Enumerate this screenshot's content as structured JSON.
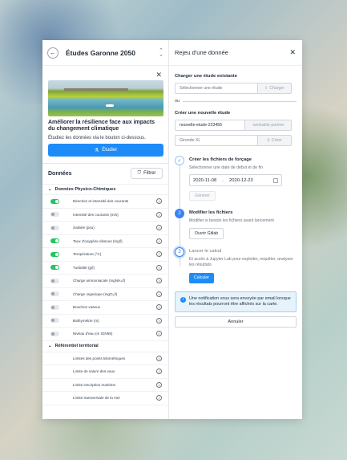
{
  "left": {
    "title": "Études Garonne 2050",
    "back_icon": "arrow-left-icon",
    "card": {
      "title": "Améliorer la résilience face aux impacts du changement climatique",
      "description": "Étudiez les données via le bouton ci-dessous.",
      "button_label": "Étudier"
    },
    "donnees_title": "Données",
    "filter_label": "Filtrer",
    "sections": [
      {
        "title": "Données Physico-Chimiques",
        "items": [
          {
            "label": "Direction et intensité des courants",
            "on": true
          },
          {
            "label": "Intensité des courants (m/s)",
            "on": false
          },
          {
            "label": "Salinité (psu)",
            "on": false
          },
          {
            "label": "Taux d'oxygène dissous (mg/l)",
            "on": true
          },
          {
            "label": "Température (°C)",
            "on": true
          },
          {
            "label": "Turbidité (g/l)",
            "on": true
          },
          {
            "label": "Charge ammoniacale (mgNH₄/l)",
            "on": false
          },
          {
            "label": "Charge organique (mgO₂/l)",
            "on": false
          },
          {
            "label": "Bouchon vaseux",
            "on": false
          },
          {
            "label": "Bathymétrie (m)",
            "on": false
          },
          {
            "label": "Niveau d'eau (m IGN69)",
            "on": false
          }
        ]
      },
      {
        "title": "Référentiel territorial",
        "items": [
          {
            "label": "Limites des points kilométriques"
          },
          {
            "label": "Limite de salure des eaux"
          },
          {
            "label": "Limite inscription maritime"
          },
          {
            "label": "Limite transversale de la mer"
          }
        ]
      }
    ]
  },
  "right": {
    "title": "Rejeu d'une donnée",
    "load_label": "Charger une étude existante",
    "select_placeholder": "Sélectionner une étude",
    "load_button": "Charger",
    "or_label": "ou",
    "create_label": "Créer une nouvelle étude",
    "new_study_name": "nouvelle-etude-223456",
    "new_study_suffix": "-workable-partner",
    "new_study_location": "Gironde XL",
    "create_button": "Créer",
    "steps": [
      {
        "title": "Créer les fichiers de forçage",
        "description": "Sélectionner une date de début et de fin",
        "start_date": "2020-11-08",
        "end_date": "2020-12-23",
        "button": "Générer"
      },
      {
        "number": "2",
        "title": "Modifier les fichiers",
        "description": "Modifier si besoin les fichiers avant lancement",
        "button": "Ouvrir Gitlab"
      },
      {
        "number": "3",
        "title": "Lancer le calcul",
        "description": "Et accès à Jupyter Lab pour exploiter, requêter, analyser les résultats",
        "button": "Calculer"
      }
    ],
    "notice": "Une notification vous sera envoyée par email lorsque les résultats pourront être affichés sur la carte.",
    "cancel_label": "Annuler"
  }
}
